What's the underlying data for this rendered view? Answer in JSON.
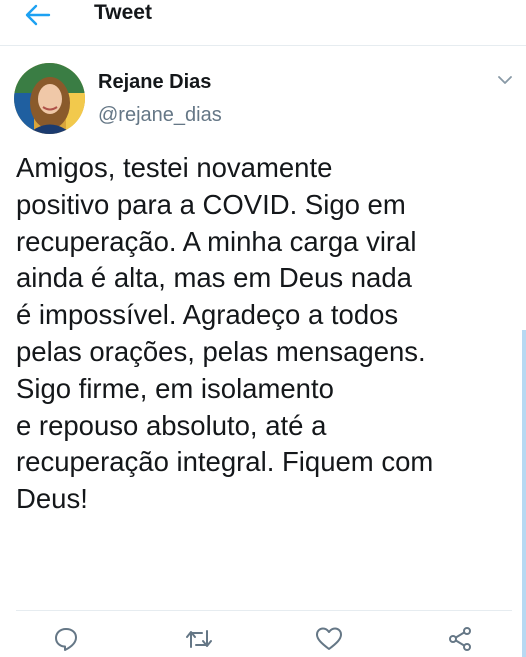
{
  "header": {
    "title": "Tweet",
    "back_icon": "arrow-left-icon"
  },
  "author": {
    "name": "Rejane Dias",
    "handle": "@rejane_dias",
    "avatar_icon": "profile-photo",
    "menu_icon": "chevron-down-icon"
  },
  "tweet": {
    "lines": [
      "Amigos, testei novamente",
      "positivo para a COVID. Sigo em",
      "recuperação. A minha carga viral",
      "ainda é alta, mas em Deus nada",
      "é impossível. Agradeço a todos",
      "pelas orações, pelas mensagens.",
      "Sigo firme, em isolamento",
      "e repouso absoluto, até a",
      "recuperação integral. Fiquem com",
      "Deus!"
    ]
  },
  "actions": [
    {
      "icon": "reply-icon"
    },
    {
      "icon": "retweet-icon"
    },
    {
      "icon": "like-icon"
    },
    {
      "icon": "share-icon"
    }
  ],
  "colors": {
    "accent": "#1da1f2",
    "text": "#14171a",
    "secondary_text": "#657786",
    "divider": "#e6ecf0"
  }
}
